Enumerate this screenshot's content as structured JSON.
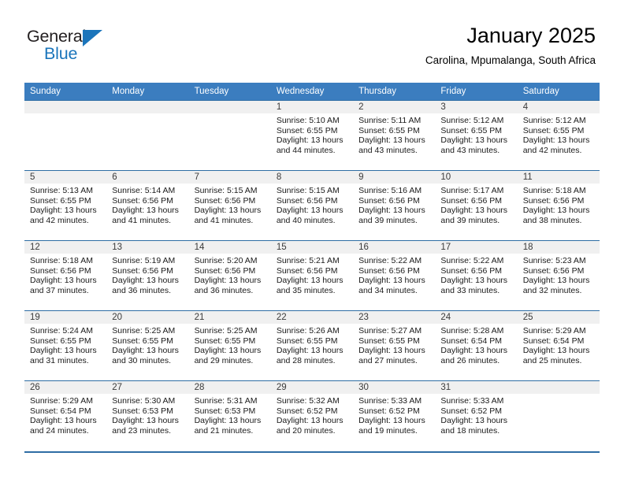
{
  "brand": {
    "name_part1": "General",
    "name_part2": "Blue",
    "logo_icon": "triangle-flag-icon",
    "color_dark": "#231f20",
    "color_blue": "#1b75bb"
  },
  "header": {
    "month_title": "January 2025",
    "location": "Carolina, Mpumalanga, South Africa"
  },
  "theme": {
    "header_row_bg": "#3b7dbf",
    "row_divider": "#2e6da4",
    "daynum_strip_bg": "#f0f0f0"
  },
  "weekday_headers": [
    "Sunday",
    "Monday",
    "Tuesday",
    "Wednesday",
    "Thursday",
    "Friday",
    "Saturday"
  ],
  "weeks": [
    [
      {
        "day": "",
        "empty": true,
        "sunrise": "",
        "sunset": "",
        "daylight1": "",
        "daylight2": ""
      },
      {
        "day": "",
        "empty": true,
        "sunrise": "",
        "sunset": "",
        "daylight1": "",
        "daylight2": ""
      },
      {
        "day": "",
        "empty": true,
        "sunrise": "",
        "sunset": "",
        "daylight1": "",
        "daylight2": ""
      },
      {
        "day": "1",
        "empty": false,
        "sunrise": "Sunrise: 5:10 AM",
        "sunset": "Sunset: 6:55 PM",
        "daylight1": "Daylight: 13 hours",
        "daylight2": "and 44 minutes."
      },
      {
        "day": "2",
        "empty": false,
        "sunrise": "Sunrise: 5:11 AM",
        "sunset": "Sunset: 6:55 PM",
        "daylight1": "Daylight: 13 hours",
        "daylight2": "and 43 minutes."
      },
      {
        "day": "3",
        "empty": false,
        "sunrise": "Sunrise: 5:12 AM",
        "sunset": "Sunset: 6:55 PM",
        "daylight1": "Daylight: 13 hours",
        "daylight2": "and 43 minutes."
      },
      {
        "day": "4",
        "empty": false,
        "sunrise": "Sunrise: 5:12 AM",
        "sunset": "Sunset: 6:55 PM",
        "daylight1": "Daylight: 13 hours",
        "daylight2": "and 42 minutes."
      }
    ],
    [
      {
        "day": "5",
        "empty": false,
        "sunrise": "Sunrise: 5:13 AM",
        "sunset": "Sunset: 6:55 PM",
        "daylight1": "Daylight: 13 hours",
        "daylight2": "and 42 minutes."
      },
      {
        "day": "6",
        "empty": false,
        "sunrise": "Sunrise: 5:14 AM",
        "sunset": "Sunset: 6:56 PM",
        "daylight1": "Daylight: 13 hours",
        "daylight2": "and 41 minutes."
      },
      {
        "day": "7",
        "empty": false,
        "sunrise": "Sunrise: 5:15 AM",
        "sunset": "Sunset: 6:56 PM",
        "daylight1": "Daylight: 13 hours",
        "daylight2": "and 41 minutes."
      },
      {
        "day": "8",
        "empty": false,
        "sunrise": "Sunrise: 5:15 AM",
        "sunset": "Sunset: 6:56 PM",
        "daylight1": "Daylight: 13 hours",
        "daylight2": "and 40 minutes."
      },
      {
        "day": "9",
        "empty": false,
        "sunrise": "Sunrise: 5:16 AM",
        "sunset": "Sunset: 6:56 PM",
        "daylight1": "Daylight: 13 hours",
        "daylight2": "and 39 minutes."
      },
      {
        "day": "10",
        "empty": false,
        "sunrise": "Sunrise: 5:17 AM",
        "sunset": "Sunset: 6:56 PM",
        "daylight1": "Daylight: 13 hours",
        "daylight2": "and 39 minutes."
      },
      {
        "day": "11",
        "empty": false,
        "sunrise": "Sunrise: 5:18 AM",
        "sunset": "Sunset: 6:56 PM",
        "daylight1": "Daylight: 13 hours",
        "daylight2": "and 38 minutes."
      }
    ],
    [
      {
        "day": "12",
        "empty": false,
        "sunrise": "Sunrise: 5:18 AM",
        "sunset": "Sunset: 6:56 PM",
        "daylight1": "Daylight: 13 hours",
        "daylight2": "and 37 minutes."
      },
      {
        "day": "13",
        "empty": false,
        "sunrise": "Sunrise: 5:19 AM",
        "sunset": "Sunset: 6:56 PM",
        "daylight1": "Daylight: 13 hours",
        "daylight2": "and 36 minutes."
      },
      {
        "day": "14",
        "empty": false,
        "sunrise": "Sunrise: 5:20 AM",
        "sunset": "Sunset: 6:56 PM",
        "daylight1": "Daylight: 13 hours",
        "daylight2": "and 36 minutes."
      },
      {
        "day": "15",
        "empty": false,
        "sunrise": "Sunrise: 5:21 AM",
        "sunset": "Sunset: 6:56 PM",
        "daylight1": "Daylight: 13 hours",
        "daylight2": "and 35 minutes."
      },
      {
        "day": "16",
        "empty": false,
        "sunrise": "Sunrise: 5:22 AM",
        "sunset": "Sunset: 6:56 PM",
        "daylight1": "Daylight: 13 hours",
        "daylight2": "and 34 minutes."
      },
      {
        "day": "17",
        "empty": false,
        "sunrise": "Sunrise: 5:22 AM",
        "sunset": "Sunset: 6:56 PM",
        "daylight1": "Daylight: 13 hours",
        "daylight2": "and 33 minutes."
      },
      {
        "day": "18",
        "empty": false,
        "sunrise": "Sunrise: 5:23 AM",
        "sunset": "Sunset: 6:56 PM",
        "daylight1": "Daylight: 13 hours",
        "daylight2": "and 32 minutes."
      }
    ],
    [
      {
        "day": "19",
        "empty": false,
        "sunrise": "Sunrise: 5:24 AM",
        "sunset": "Sunset: 6:55 PM",
        "daylight1": "Daylight: 13 hours",
        "daylight2": "and 31 minutes."
      },
      {
        "day": "20",
        "empty": false,
        "sunrise": "Sunrise: 5:25 AM",
        "sunset": "Sunset: 6:55 PM",
        "daylight1": "Daylight: 13 hours",
        "daylight2": "and 30 minutes."
      },
      {
        "day": "21",
        "empty": false,
        "sunrise": "Sunrise: 5:25 AM",
        "sunset": "Sunset: 6:55 PM",
        "daylight1": "Daylight: 13 hours",
        "daylight2": "and 29 minutes."
      },
      {
        "day": "22",
        "empty": false,
        "sunrise": "Sunrise: 5:26 AM",
        "sunset": "Sunset: 6:55 PM",
        "daylight1": "Daylight: 13 hours",
        "daylight2": "and 28 minutes."
      },
      {
        "day": "23",
        "empty": false,
        "sunrise": "Sunrise: 5:27 AM",
        "sunset": "Sunset: 6:55 PM",
        "daylight1": "Daylight: 13 hours",
        "daylight2": "and 27 minutes."
      },
      {
        "day": "24",
        "empty": false,
        "sunrise": "Sunrise: 5:28 AM",
        "sunset": "Sunset: 6:54 PM",
        "daylight1": "Daylight: 13 hours",
        "daylight2": "and 26 minutes."
      },
      {
        "day": "25",
        "empty": false,
        "sunrise": "Sunrise: 5:29 AM",
        "sunset": "Sunset: 6:54 PM",
        "daylight1": "Daylight: 13 hours",
        "daylight2": "and 25 minutes."
      }
    ],
    [
      {
        "day": "26",
        "empty": false,
        "sunrise": "Sunrise: 5:29 AM",
        "sunset": "Sunset: 6:54 PM",
        "daylight1": "Daylight: 13 hours",
        "daylight2": "and 24 minutes."
      },
      {
        "day": "27",
        "empty": false,
        "sunrise": "Sunrise: 5:30 AM",
        "sunset": "Sunset: 6:53 PM",
        "daylight1": "Daylight: 13 hours",
        "daylight2": "and 23 minutes."
      },
      {
        "day": "28",
        "empty": false,
        "sunrise": "Sunrise: 5:31 AM",
        "sunset": "Sunset: 6:53 PM",
        "daylight1": "Daylight: 13 hours",
        "daylight2": "and 21 minutes."
      },
      {
        "day": "29",
        "empty": false,
        "sunrise": "Sunrise: 5:32 AM",
        "sunset": "Sunset: 6:52 PM",
        "daylight1": "Daylight: 13 hours",
        "daylight2": "and 20 minutes."
      },
      {
        "day": "30",
        "empty": false,
        "sunrise": "Sunrise: 5:33 AM",
        "sunset": "Sunset: 6:52 PM",
        "daylight1": "Daylight: 13 hours",
        "daylight2": "and 19 minutes."
      },
      {
        "day": "31",
        "empty": false,
        "sunrise": "Sunrise: 5:33 AM",
        "sunset": "Sunset: 6:52 PM",
        "daylight1": "Daylight: 13 hours",
        "daylight2": "and 18 minutes."
      },
      {
        "day": "",
        "empty": true,
        "sunrise": "",
        "sunset": "",
        "daylight1": "",
        "daylight2": ""
      }
    ]
  ]
}
